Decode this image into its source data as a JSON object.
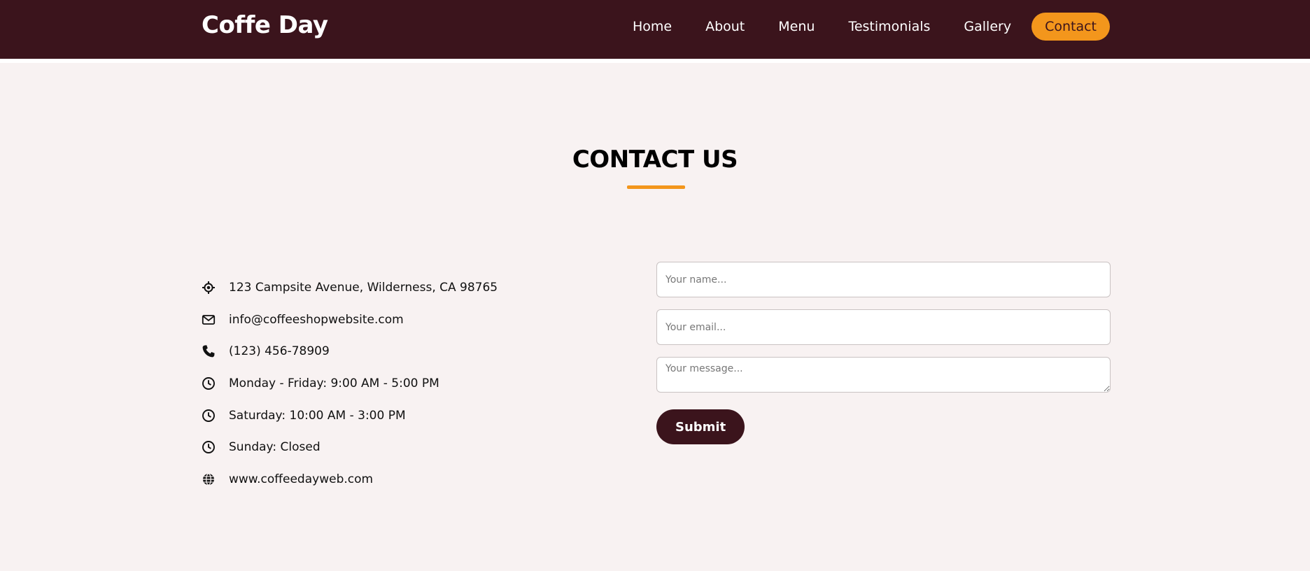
{
  "header": {
    "logo": "Coffe Day",
    "nav": [
      {
        "label": "Home",
        "icon": null
      },
      {
        "label": "About"
      },
      {
        "label": "Menu"
      },
      {
        "label": "Testimonials"
      },
      {
        "label": "Gallery"
      },
      {
        "label": "Contact"
      }
    ],
    "active_nav": "Contact"
  },
  "contact": {
    "title": "CONTACT US",
    "info": [
      {
        "icon": "location-crosshair-icon",
        "text": "123 Campsite Avenue, Wilderness, CA 98765"
      },
      {
        "icon": "envelope-icon",
        "text": "info@coffeeshopwebsite.com"
      },
      {
        "icon": "phone-icon",
        "text": "(123) 456-78909"
      },
      {
        "icon": "clock-icon",
        "text": "Monday - Friday: 9:00 AM - 5:00 PM"
      },
      {
        "icon": "clock-icon",
        "text": "Saturday: 10:00 AM - 3:00 PM"
      },
      {
        "icon": "clock-icon",
        "text": "Sunday: Closed"
      },
      {
        "icon": "globe-icon",
        "text": "www.coffeedayweb.com"
      }
    ]
  },
  "form": {
    "name_placeholder": "Your name...",
    "email_placeholder": "Your email...",
    "message_placeholder": "Your message...",
    "submit_label": "Submit"
  },
  "colors": {
    "brand_dark": "#3b141c",
    "accent": "#f3961c",
    "background": "#f8f2f2"
  }
}
